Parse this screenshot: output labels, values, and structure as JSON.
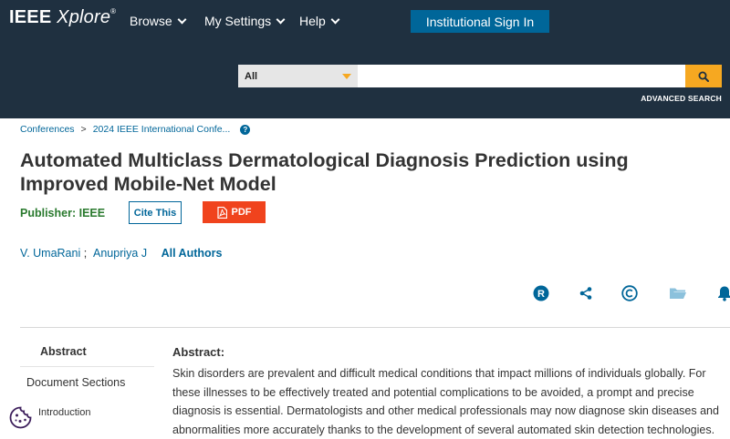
{
  "header": {
    "logo_main": "IEEE",
    "logo_sub": "Xplore",
    "logo_reg": "®",
    "nav": [
      "Browse",
      "My Settings",
      "Help"
    ],
    "signin_label": "Institutional Sign In",
    "search_scope": "All",
    "search_value": "",
    "advanced_search": "ADVANCED SEARCH",
    "accent_color": "#f6a821",
    "bg_color": "#1f3040"
  },
  "breadcrumb": {
    "items": [
      "Conferences",
      "2024 IEEE International Confe..."
    ],
    "separator": ">"
  },
  "article": {
    "title": "Automated Multiclass Dermatological Diagnosis Prediction using Improved Mobile-Net Model",
    "publisher_label": "Publisher:",
    "publisher": "IEEE",
    "cite_label": "Cite This",
    "pdf_label": "PDF",
    "authors": [
      "V. UmaRani",
      "Anupriya J"
    ],
    "author_sep": ";",
    "all_authors": "All Authors",
    "actions": [
      "rights-icon",
      "share-icon",
      "copyright-icon",
      "folder-icon",
      "bell-icon"
    ]
  },
  "sidebar": {
    "abstract": "Abstract",
    "document_sections": "Document Sections",
    "introduction": "Introduction"
  },
  "abstract": {
    "heading": "Abstract:",
    "text": "Skin disorders are prevalent and difficult medical conditions that impact millions of individuals globally. For these illnesses to be effectively treated and potential complications to be avoided, a prompt and precise diagnosis is essential. Dermatologists and other medical professionals may now diagnose skin diseases and abnormalities more accurately thanks to the development of several automated skin detection technologies."
  }
}
